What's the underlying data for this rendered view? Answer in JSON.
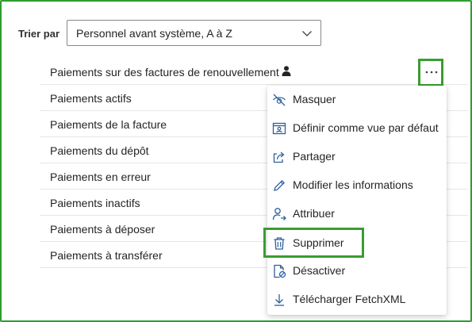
{
  "sort": {
    "label": "Trier par",
    "selected": "Personnel avant système, A à Z"
  },
  "views": [
    {
      "label": "Paiements sur des factures de renouvellement",
      "personal": true
    },
    {
      "label": "Paiements actifs"
    },
    {
      "label": "Paiements de la facture"
    },
    {
      "label": "Paiements du dépôt"
    },
    {
      "label": "Paiements en erreur"
    },
    {
      "label": "Paiements inactifs"
    },
    {
      "label": "Paiements à déposer"
    },
    {
      "label": "Paiements à transférer"
    }
  ],
  "more_button": {
    "icon": "more-horizontal-icon"
  },
  "context_menu": {
    "items": [
      {
        "label": "Masquer",
        "icon": "eye-hidden-icon"
      },
      {
        "label": "Définir comme vue par défaut",
        "icon": "set-default-view-icon"
      },
      {
        "label": "Partager",
        "icon": "share-icon"
      },
      {
        "label": "Modifier les informations",
        "icon": "edit-pencil-icon"
      },
      {
        "label": "Attribuer",
        "icon": "assign-person-icon"
      },
      {
        "label": "Supprimer",
        "icon": "trash-icon",
        "highlighted": true
      },
      {
        "label": "Désactiver",
        "icon": "deactivate-icon"
      },
      {
        "label": "Télécharger FetchXML",
        "icon": "download-icon"
      }
    ]
  },
  "colors": {
    "highlight": "#3a9d2f",
    "icon_blue": "#2d5f9e",
    "frame": "#2e9e2e"
  }
}
